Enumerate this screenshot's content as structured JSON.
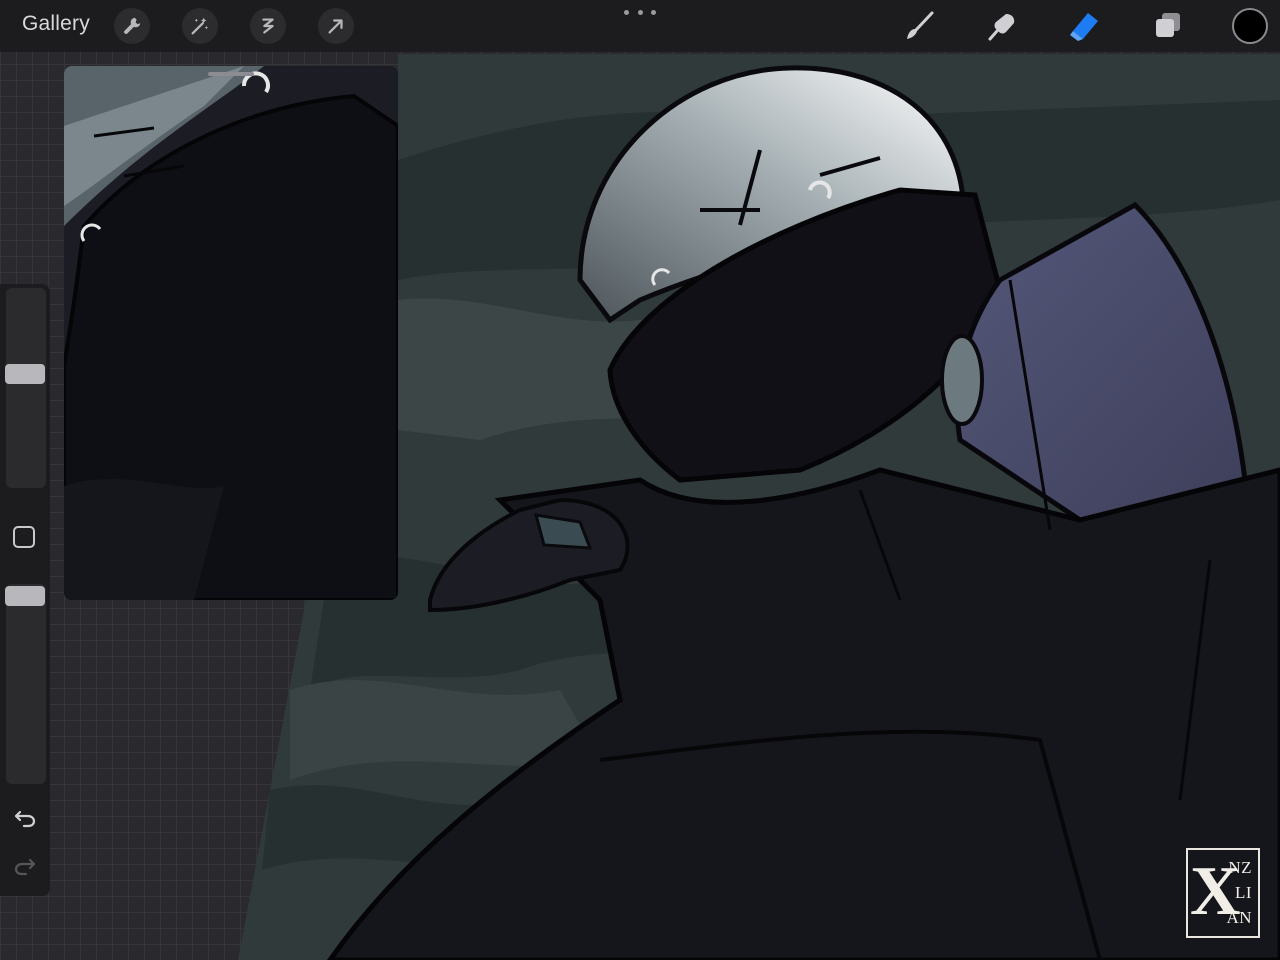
{
  "toolbar": {
    "gallery_label": "Gallery",
    "left_tools": [
      "wrench-icon",
      "magic-wand-icon",
      "selection-icon",
      "transform-arrow-icon"
    ],
    "right_tools": [
      "brush-icon",
      "smudge-icon",
      "eraser-icon",
      "layers-icon"
    ],
    "active_tool": "eraser-icon",
    "active_color": "#000000",
    "accent": "#1e7cf2"
  },
  "sidebar": {
    "brush_size_level": 0.4,
    "opacity_level": 1.0
  },
  "reference_window": {
    "visible": true
  },
  "signature": {
    "monogram": "X",
    "line1": "NZ",
    "line2": "LI",
    "line3": "AN"
  }
}
